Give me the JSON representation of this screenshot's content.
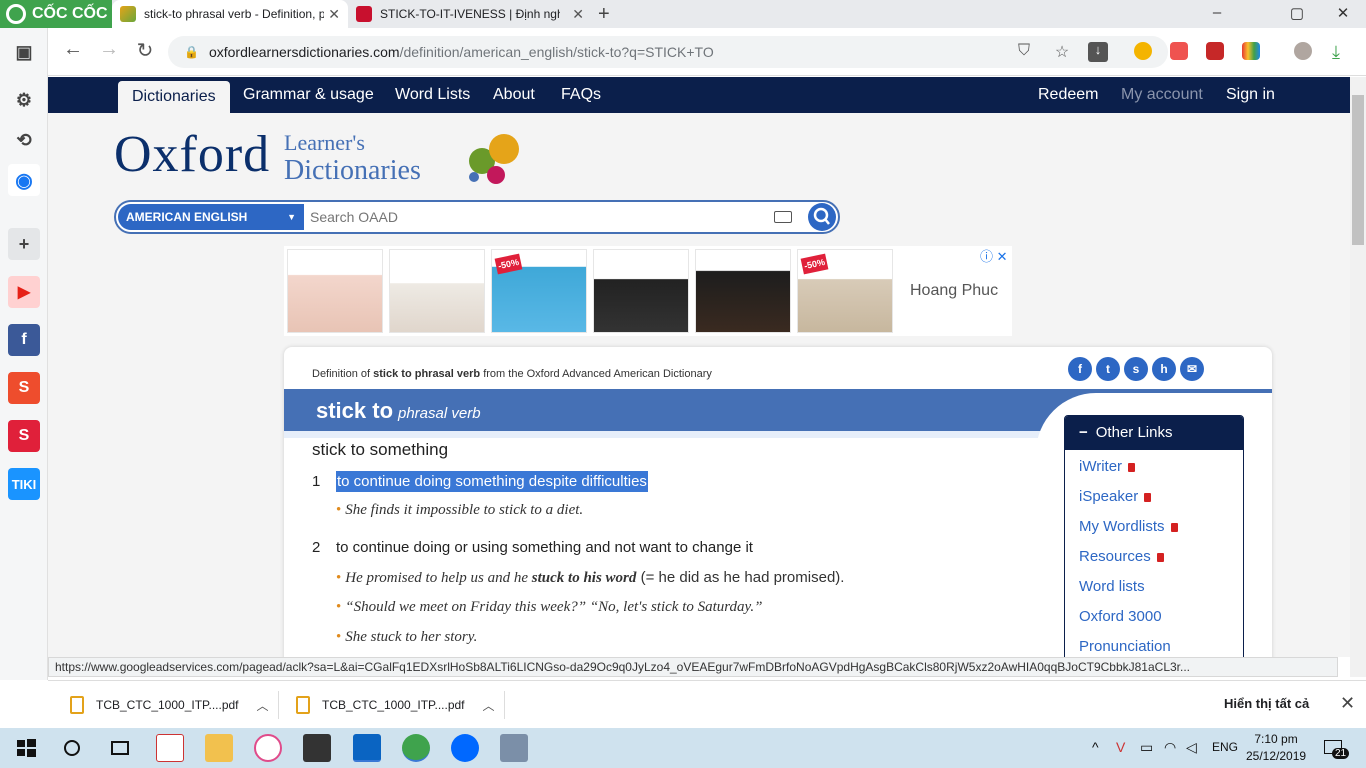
{
  "browser": {
    "brand": "CỐC CỐC",
    "tabs": [
      {
        "title": "stick-to phrasal verb - Definition, p"
      },
      {
        "title": "STICK-TO-IT-IVENESS | Định nghĩa"
      }
    ],
    "new_tab": "+",
    "window_controls": {
      "minimize": "–",
      "maximize": "▢",
      "close": "✕"
    },
    "url_host": "oxfordlearnersdictionaries.com",
    "url_path": "/definition/american_english/stick-to?q=STICK+TO"
  },
  "site_nav": {
    "left": [
      "Dictionaries",
      "Grammar & usage",
      "Word Lists",
      "About",
      "FAQs"
    ],
    "right": [
      "Redeem",
      "My account",
      "Sign in"
    ]
  },
  "brand": {
    "oxford": "Oxford",
    "line1": "Learner's",
    "line2": "Dictionaries"
  },
  "search": {
    "dictionary": "AMERICAN ENGLISH",
    "placeholder": "Search OAAD"
  },
  "ad": {
    "brand": "Hoang Phuc",
    "badge1": "-50%",
    "badge2": "-50%",
    "info": "ⓘ ✕"
  },
  "entry": {
    "crumb_prefix": "Definition of ",
    "crumb_bold": "stick to phrasal verb",
    "crumb_suffix": " from the Oxford Advanced American Dictionary",
    "headword": "stick to",
    "pos": "phrasal verb",
    "idiom": "stick to something",
    "senses": [
      {
        "num": "1",
        "def": "to continue doing something despite difficulties"
      },
      {
        "num": "2",
        "def": "to continue doing or using something and not want to change it"
      }
    ],
    "ex1": "She finds it impossible to stick to a diet.",
    "ex2a": "He promised to help us and he ",
    "ex2b": "stuck to his word",
    "ex2c": " (= he did as he had promised).",
    "ex3": "“Should we meet on Friday this week?” “No, let's stick to Saturday.”",
    "ex4": "She stuck to her story."
  },
  "other_links": {
    "title": "Other Links",
    "items": [
      "iWriter",
      "iSpeaker",
      "My Wordlists",
      "Resources",
      "Word lists",
      "Oxford 3000",
      "Pronunciation"
    ]
  },
  "status_url": "https://www.googleadservices.com/pagead/aclk?sa=L&ai=CGalFq1EDXsrlHoSb8ALTi6LICNGso-da29Oc9q0JyLzo4_oVEAEgur7wFmDBrfoNoAGVpdHgAsgBCakCls80RjW5xz2oAwHIA0qqBJoCT9CbbkJ81aCL3r...",
  "downloads": {
    "items": [
      "TCB_CTC_1000_ITP....pdf",
      "TCB_CTC_1000_ITP....pdf"
    ],
    "show_all": "Hiển thị tất cả",
    "close": "✕"
  },
  "taskbar": {
    "lang": "ENG",
    "time": "7:10 pm",
    "date": "25/12/2019",
    "notifications": "21"
  },
  "colors": {
    "oxford_navy": "#0b1f4b",
    "oxford_blue": "#4570b5",
    "link_blue": "#2d67c4",
    "highlight": "#3a78d6",
    "coccoc_green": "#3fa34d"
  }
}
